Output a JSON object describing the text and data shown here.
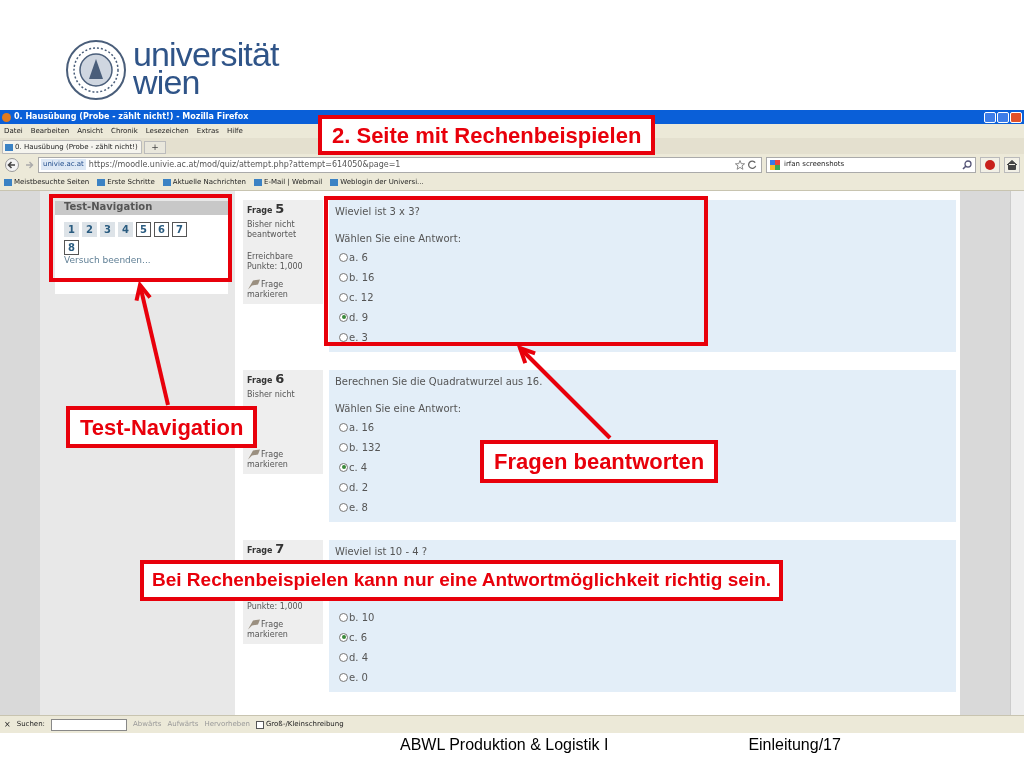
{
  "slide": {
    "logo_lines": [
      "universität",
      "wien"
    ],
    "footer_title": "ABWL Produktion & Logistik I",
    "footer_page": "Einleitung/17"
  },
  "browser": {
    "title": "0. Hausübung (Probe - zählt nicht!) - Mozilla Firefox",
    "menu": [
      "Datei",
      "Bearbeiten",
      "Ansicht",
      "Chronik",
      "Lesezeichen",
      "Extras",
      "Hilfe"
    ],
    "tab": "0. Hausübung (Probe - zählt nicht!)",
    "new_tab": "+",
    "site_badge": "univie.ac.at",
    "url": "https://moodle.univie.ac.at/mod/quiz/attempt.php?attempt=614050&page=1",
    "search": "irfan screenshots",
    "bookmarks": [
      "Meistbesuchte Seiten",
      "Erste Schritte",
      "Aktuelle Nachrichten",
      "E-Mail | Webmail",
      "Weblogin der Universi..."
    ],
    "find_bar": {
      "close": "×",
      "label": "Suchen:",
      "buttons": [
        "Abwärts",
        "Aufwärts",
        "Hervorheben"
      ],
      "checkbox": {
        "label": "Groß-/Kleinschreibung",
        "checked": false
      }
    }
  },
  "quiz_nav": {
    "title": "Test-Navigation",
    "buttons": [
      {
        "label": "1",
        "current": false
      },
      {
        "label": "2",
        "current": false
      },
      {
        "label": "3",
        "current": false
      },
      {
        "label": "4",
        "current": false
      },
      {
        "label": "5",
        "current": true
      },
      {
        "label": "6",
        "current": true
      },
      {
        "label": "7",
        "current": true
      },
      {
        "label": "8",
        "current": true
      }
    ],
    "finish_link": "Versuch beenden..."
  },
  "questions": [
    {
      "label": "Frage",
      "number": "5",
      "status": [
        "Bisher nicht",
        "beantwortet"
      ],
      "points": [
        "Erreichbare",
        "Punkte: 1,000"
      ],
      "flag": [
        "Frage",
        "markieren"
      ],
      "text": "Wieviel ist 3 x 3?",
      "prompt": "Wählen Sie eine Antwort:",
      "options": [
        {
          "label": "a. 6",
          "selected": false
        },
        {
          "label": "b. 16",
          "selected": false
        },
        {
          "label": "c. 12",
          "selected": false
        },
        {
          "label": "d. 9",
          "selected": true
        },
        {
          "label": "e. 3",
          "selected": false
        }
      ]
    },
    {
      "label": "Frage",
      "number": "6",
      "status": [
        "Bisher nicht"
      ],
      "flag": [
        "Frage",
        "markieren"
      ],
      "text": "Berechnen Sie die Quadratwurzel aus 16.",
      "prompt": "Wählen Sie eine Antwort:",
      "options": [
        {
          "label": "a. 16",
          "selected": false
        },
        {
          "label": "b. 132",
          "selected": false
        },
        {
          "label": "c. 4",
          "selected": true
        },
        {
          "label": "d. 2",
          "selected": false
        },
        {
          "label": "e. 8",
          "selected": false
        }
      ]
    },
    {
      "label": "Frage",
      "number": "7",
      "points": [
        "Punkte: 1,000"
      ],
      "flag": [
        "Frage",
        "markieren"
      ],
      "text": "Wieviel ist 10 - 4 ?",
      "options": [
        {
          "label": "b. 10",
          "selected": false
        },
        {
          "label": "c. 6",
          "selected": true
        },
        {
          "label": "d. 4",
          "selected": false
        },
        {
          "label": "e. 0",
          "selected": false
        }
      ]
    }
  ],
  "annotations": [
    {
      "kind": "page",
      "text": "2. Seite mit Rechenbeispielen"
    },
    {
      "kind": "navigation",
      "text": "Test-Navigation"
    },
    {
      "kind": "answer",
      "text": "Fragen beantworten"
    },
    {
      "kind": "note",
      "text": "Bei Rechenbeispielen kann nur eine Antwortmöglichkeit richtig sein."
    }
  ]
}
